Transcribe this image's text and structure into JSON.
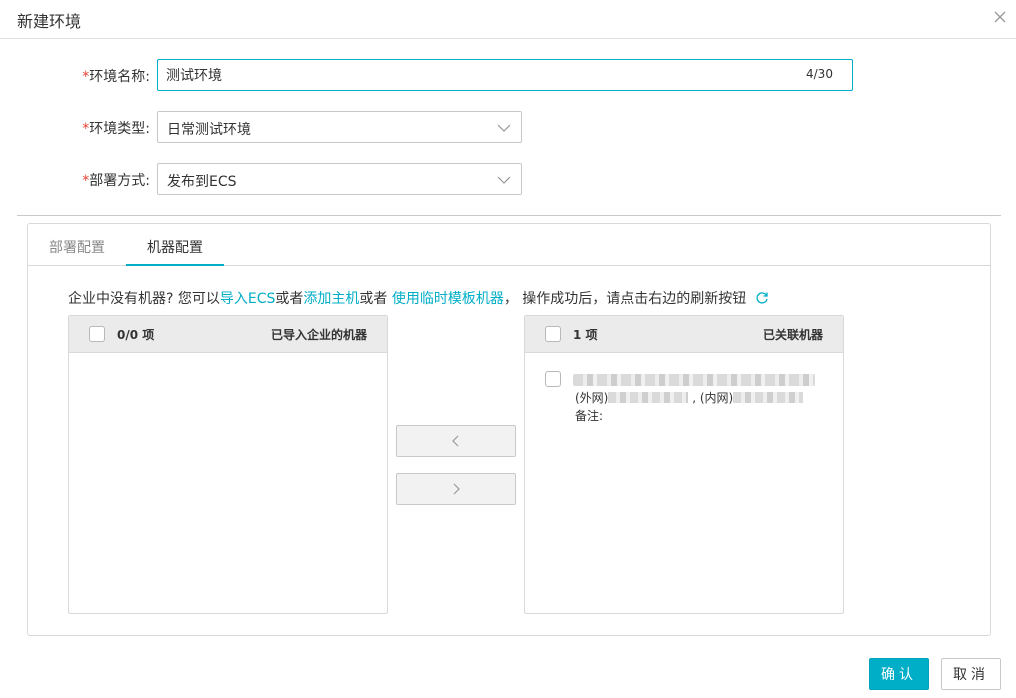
{
  "dialog": {
    "title": "新建环境"
  },
  "form": {
    "required_mark": "*",
    "name_label": "环境名称:",
    "name_value": "测试环境",
    "name_counter": "4/30",
    "type_label": "环境类型:",
    "type_value": "日常测试环境",
    "deploy_label": "部署方式:",
    "deploy_value": "发布到ECS"
  },
  "tabs": [
    {
      "label": "部署配置",
      "active": false
    },
    {
      "label": "机器配置",
      "active": true
    }
  ],
  "hint": {
    "prefix": "企业中没有机器? 您可以",
    "link_import": "导入ECS",
    "or1": "或者",
    "link_add_host": "添加主机",
    "or2": "或者 ",
    "link_template": "使用临时模板机器",
    "suffix": "， 操作成功后，请点击右边的刷新按钮"
  },
  "transfer": {
    "left": {
      "count": "0/0 项",
      "title": "已导入企业的机器"
    },
    "right": {
      "count": "1 项",
      "title": "已关联机器",
      "item": {
        "public_label": "(外网)",
        "separator": ",",
        "private_label": "(内网)",
        "note_label": "备注:"
      }
    }
  },
  "footer": {
    "confirm": "确认",
    "cancel": "取消"
  },
  "colors": {
    "accent": "#00aec7",
    "required": "#e53e2e"
  }
}
